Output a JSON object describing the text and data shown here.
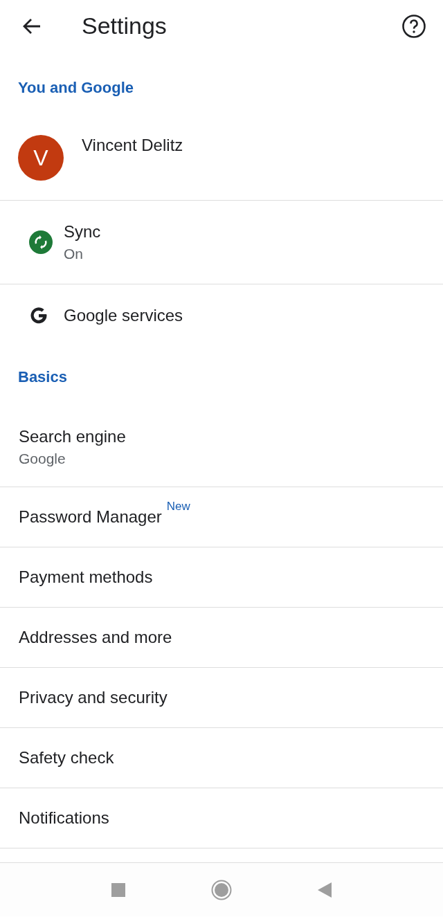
{
  "app_bar": {
    "title": "Settings"
  },
  "sections": [
    {
      "header": "You and Google",
      "items": [
        {
          "kind": "account",
          "title": "Vincent Delitz",
          "initial": "V",
          "divider": true
        },
        {
          "kind": "sync",
          "title": "Sync",
          "subtitle": "On",
          "divider": true
        },
        {
          "kind": "google",
          "title": "Google services",
          "divider": false
        }
      ]
    },
    {
      "header": "Basics",
      "items": [
        {
          "kind": "plain",
          "title": "Search engine",
          "subtitle": "Google",
          "divider": true
        },
        {
          "kind": "plain",
          "title": "Password Manager",
          "badge": "New",
          "divider": true
        },
        {
          "kind": "plain",
          "title": "Payment methods",
          "divider": true
        },
        {
          "kind": "plain",
          "title": "Addresses and more",
          "divider": true
        },
        {
          "kind": "plain",
          "title": "Privacy and security",
          "divider": true
        },
        {
          "kind": "plain",
          "title": "Safety check",
          "divider": true
        },
        {
          "kind": "plain",
          "title": "Notifications",
          "divider": true
        }
      ]
    }
  ]
}
